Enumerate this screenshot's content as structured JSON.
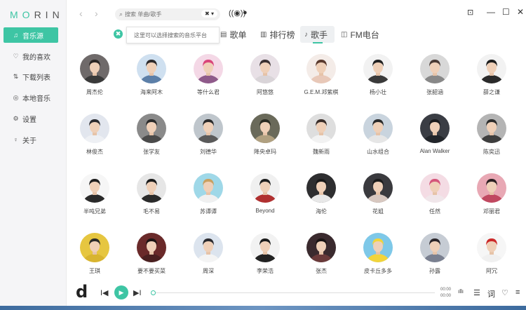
{
  "app": {
    "logo_left": "MO",
    "logo_right": "RIN"
  },
  "sidebar": {
    "items": [
      {
        "icon": "music-icon",
        "glyph": "♫",
        "label": "音乐源",
        "active": true
      },
      {
        "icon": "heart-icon",
        "glyph": "♡",
        "label": "我的喜欢"
      },
      {
        "icon": "download-icon",
        "glyph": "⇅",
        "label": "下载列表"
      },
      {
        "icon": "local-music-icon",
        "glyph": "◎",
        "label": "本地音乐"
      },
      {
        "icon": "settings-icon",
        "glyph": "⚙",
        "label": "设置"
      },
      {
        "icon": "about-icon",
        "glyph": "♀",
        "label": "关于"
      }
    ]
  },
  "topbar": {
    "back": "‹",
    "forward": "›",
    "search_icon": "⌕",
    "search_placeholder": "搜索 单曲/歌手",
    "source_selector": "✖ ▾",
    "controls": {
      "minimize": "—",
      "maximize": "☐",
      "close": "✕"
    }
  },
  "tooltip": {
    "icon": "✖",
    "text": "这里可以选择搜索的音乐平台"
  },
  "tabs": [
    {
      "icon": "▤",
      "label": "歌单"
    },
    {
      "icon": "▥",
      "label": "排行榜"
    },
    {
      "icon": "♪",
      "label": "歌手",
      "active": true
    },
    {
      "icon": "◫",
      "label": "FM电台"
    }
  ],
  "singers": [
    {
      "name": "周杰伦",
      "bg": "#6f6a6a",
      "hair": "#2b2624",
      "shirt": "#3a3a3a"
    },
    {
      "name": "海来阿木",
      "bg": "#cfe0f0",
      "hair": "#2d2a2c",
      "shirt": "#5c7fa8"
    },
    {
      "name": "等什么君",
      "bg": "#f4d8e6",
      "hair": "#d9467a",
      "shirt": "#8f5a8a"
    },
    {
      "name": "阿悠悠",
      "bg": "#e8e0e6",
      "hair": "#3a3030",
      "shirt": "#d9d4d8"
    },
    {
      "name": "G.E.M.邓紫棋",
      "bg": "#f4ece8",
      "hair": "#5a3a2e",
      "shirt": "#e8c8b8"
    },
    {
      "name": "杨小壮",
      "bg": "#f2f2f2",
      "hair": "#222222",
      "shirt": "#3a3a3a"
    },
    {
      "name": "张韶涵",
      "bg": "#d8d8d8",
      "hair": "#4a3a34",
      "shirt": "#888888"
    },
    {
      "name": "薛之谦",
      "bg": "#f2f2f2",
      "hair": "#1e1e1e",
      "shirt": "#2a2a2a"
    },
    {
      "name": "林俊杰",
      "bg": "#e2e6ee",
      "hair": "#2a2a2e",
      "shirt": "#eef0f4"
    },
    {
      "name": "张学友",
      "bg": "#8a8a8a",
      "hair": "#2a2a2a",
      "shirt": "#4a4a4a"
    },
    {
      "name": "刘德华",
      "bg": "#bfc6cc",
      "hair": "#2a2a2a",
      "shirt": "#5a5a5a"
    },
    {
      "name": "降央卓玛",
      "bg": "#6a6a5a",
      "hair": "#2a2a22",
      "shirt": "#b0a080"
    },
    {
      "name": "魏新雨",
      "bg": "#dedede",
      "hair": "#3a2e2a",
      "shirt": "#f2f2f2"
    },
    {
      "name": "山水组合",
      "bg": "#c9d4de",
      "hair": "#2a2a2a",
      "shirt": "#e6e6e6"
    },
    {
      "name": "Alan Walker",
      "bg": "#3a3d44",
      "hair": "#1a1a1c",
      "shirt": "#22252a"
    },
    {
      "name": "陈奕迅",
      "bg": "#b4b4b4",
      "hair": "#2c2c2c",
      "shirt": "#3e3e3e"
    },
    {
      "name": "半吨兄弟",
      "bg": "#f6f6f6",
      "hair": "#1e1e1e",
      "shirt": "#2a2a2a"
    },
    {
      "name": "毛不易",
      "bg": "#e6e6e6",
      "hair": "#1c1c1c",
      "shirt": "#2a2a2a"
    },
    {
      "name": "苏谭谭",
      "bg": "#9fd8e8",
      "hair": "#c9a060",
      "shirt": "#f0f0f0"
    },
    {
      "name": "Beyond",
      "bg": "#f0f0f0",
      "hair": "#1e1e1e",
      "shirt": "#b03030"
    },
    {
      "name": "海伦",
      "bg": "#2e2e30",
      "hair": "#1a1a1a",
      "shirt": "#e8e8e8"
    },
    {
      "name": "花姐",
      "bg": "#3a3a3e",
      "hair": "#1c1c1c",
      "shirt": "#d8c8c0"
    },
    {
      "name": "任然",
      "bg": "#f4dce4",
      "hair": "#d4567a",
      "shirt": "#f0e6ea"
    },
    {
      "name": "邓丽君",
      "bg": "#e8a8b4",
      "hair": "#2c2022",
      "shirt": "#c04860"
    },
    {
      "name": "王琪",
      "bg": "#e6c640",
      "hair": "#2a2a2a",
      "shirt": "#d8b430"
    },
    {
      "name": "要不要买菜",
      "bg": "#6a2a2a",
      "hair": "#1e1414",
      "shirt": "#4a2020"
    },
    {
      "name": "周深",
      "bg": "#dce4ee",
      "hair": "#2a2a2e",
      "shirt": "#f4f4f4"
    },
    {
      "name": "李荣浩",
      "bg": "#f2f2f2",
      "hair": "#1a1a1a",
      "shirt": "#222222"
    },
    {
      "name": "张杰",
      "bg": "#3a2a2e",
      "hair": "#1a1414",
      "shirt": "#6a3a3a"
    },
    {
      "name": "皮卡丘多多",
      "bg": "#7ec8e8",
      "hair": "#f2d43a",
      "shirt": "#f2d43a"
    },
    {
      "name": "孙露",
      "bg": "#c6ccd4",
      "hair": "#2a2428",
      "shirt": "#7a8090"
    },
    {
      "name": "阿冗",
      "bg": "#f6f6f6",
      "hair": "#cc2a2a",
      "shirt": "#f0f0f0"
    }
  ],
  "player": {
    "logo": "d",
    "prev": "I◀",
    "play": "▶",
    "next": "▶I",
    "progress": 0,
    "time_current": "00:00",
    "time_total": "00:00",
    "icons": [
      {
        "name": "equalizer-icon",
        "glyph": "ıllı"
      },
      {
        "name": "playlist-icon",
        "glyph": "☰"
      },
      {
        "name": "lyrics-icon",
        "glyph": "词"
      },
      {
        "name": "like-icon",
        "glyph": "♡"
      },
      {
        "name": "queue-icon",
        "glyph": "≡"
      }
    ]
  },
  "colors": {
    "accent": "#3ec5a4"
  }
}
